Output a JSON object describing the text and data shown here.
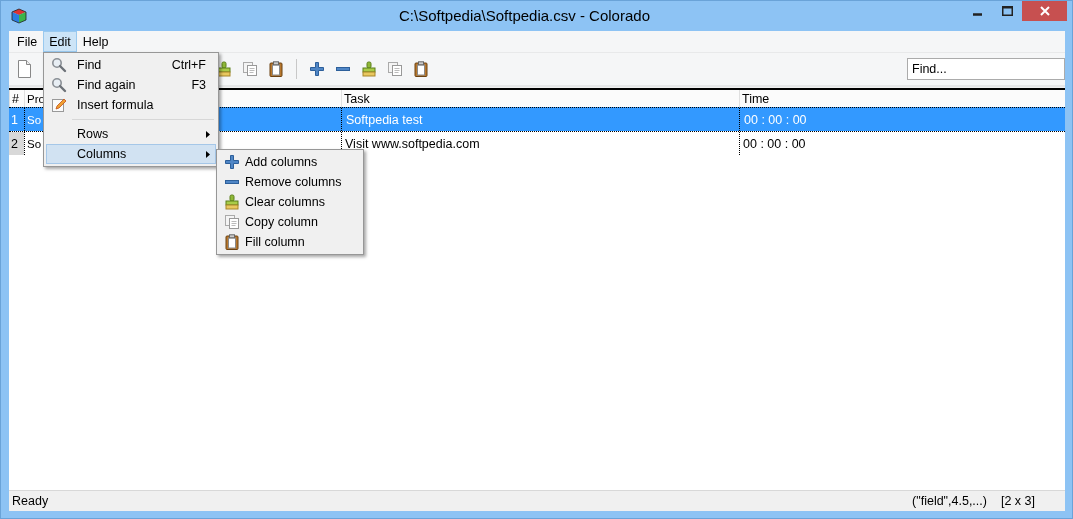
{
  "window": {
    "title": "C:\\Softpedia\\Softpedia.csv - Colorado"
  },
  "menubar": [
    {
      "label": "File",
      "selected": false
    },
    {
      "label": "Edit",
      "selected": true
    },
    {
      "label": "Help",
      "selected": false
    }
  ],
  "find_field": {
    "placeholder": "Find..."
  },
  "table": {
    "columns": [
      "#",
      "Pro",
      "Task",
      "Time"
    ],
    "rows": [
      {
        "cells": [
          "1",
          "So",
          "Softpedia test",
          "00 : 00 : 00"
        ],
        "selected": true
      },
      {
        "cells": [
          "2",
          "So",
          "Visit www.softpedia.com",
          "00 : 00 : 00"
        ],
        "selected": false
      }
    ]
  },
  "edit_menu": [
    {
      "label": "Find",
      "shortcut": "Ctrl+F",
      "kind": "item",
      "selected": false
    },
    {
      "label": "Find again",
      "shortcut": "F3",
      "kind": "item",
      "selected": false
    },
    {
      "label": "Insert formula",
      "kind": "item",
      "selected": false
    },
    {
      "kind": "separator"
    },
    {
      "label": "Rows",
      "kind": "submenu",
      "selected": false
    },
    {
      "label": "Columns",
      "kind": "submenu",
      "selected": true
    }
  ],
  "columns_submenu": [
    {
      "label": "Add columns"
    },
    {
      "label": "Remove columns"
    },
    {
      "label": "Clear columns"
    },
    {
      "label": "Copy column"
    },
    {
      "label": "Fill column"
    }
  ],
  "status_bar": {
    "message": "Ready",
    "example": "(\"field\",4.5,...)",
    "size": "[2 x 3]"
  }
}
